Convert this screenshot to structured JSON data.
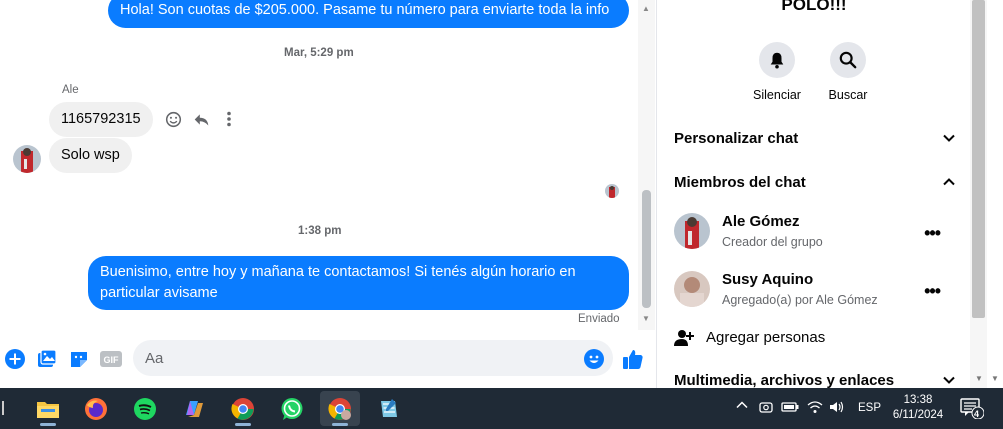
{
  "chat": {
    "messages": {
      "top_outgoing": "Hola! Son cuotas de $205.000. Pasame tu número para enviarte toda la info",
      "timestamp_1": "Mar, 5:29 pm",
      "sender_name": "Ale",
      "incoming_1": "1165792315",
      "incoming_2": "Solo wsp",
      "timestamp_2": "1:38 pm",
      "outgoing_2": "Buenisimo, entre hoy y mañana te contactamos! Si tenés algún horario en particular avisame",
      "status": "Enviado"
    },
    "composer": {
      "placeholder": "Aa"
    }
  },
  "panel": {
    "title": "POLO!!!",
    "actions": [
      {
        "label": "Silenciar",
        "icon": "bell-icon"
      },
      {
        "label": "Buscar",
        "icon": "search-icon"
      }
    ],
    "sections": {
      "customize": "Personalizar chat",
      "members": "Miembros del chat",
      "media": "Multimedia, archivos y enlaces"
    },
    "members": [
      {
        "name": "Ale Gómez",
        "role": "Creador del grupo"
      },
      {
        "name": "Susy Aquino",
        "role": "Agregado(a) por Ale Gómez"
      }
    ],
    "add_people": "Agregar personas"
  },
  "taskbar": {
    "language": "ESP",
    "time": "13:38",
    "date": "6/11/2024",
    "notification_count": "4"
  },
  "colors": {
    "accent": "#0a7cff",
    "taskbar": "#1f2a36"
  }
}
